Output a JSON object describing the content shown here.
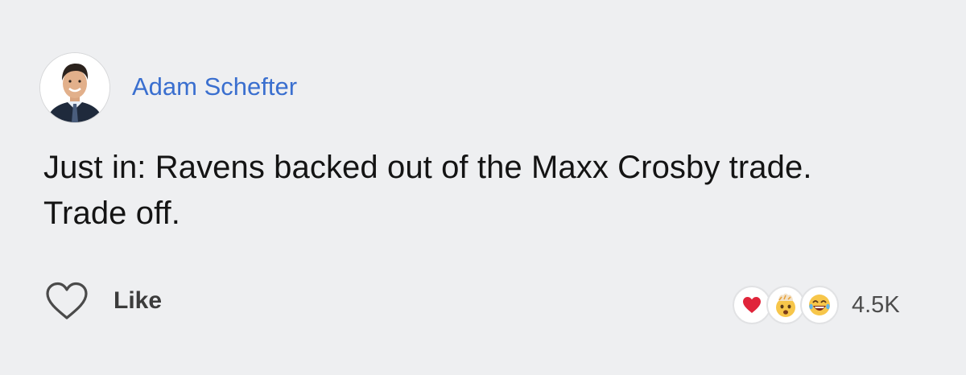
{
  "post": {
    "author": "Adam Schefter",
    "text_lines": [
      "Just in: Ravens backed out of the Maxx Crosby trade.",
      "Trade off."
    ],
    "like_label": "Like",
    "reaction_count": "4.5K",
    "reactions": [
      "heart-icon",
      "mind-blown-emoji-icon",
      "laughing-emoji-icon"
    ]
  },
  "colors": {
    "background": "#eeeff1",
    "author_name": "#3a6fcf",
    "text": "#141414",
    "heart": "#e0243a"
  }
}
